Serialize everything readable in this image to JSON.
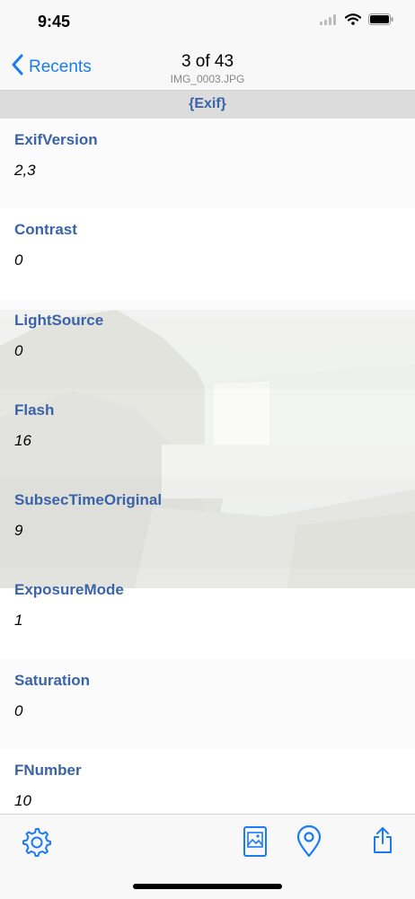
{
  "status_bar": {
    "time": "9:45"
  },
  "nav": {
    "back_label": "Recents",
    "title": "3 of 43",
    "subtitle": "IMG_0003.JPG"
  },
  "section": {
    "title": "{Exif}"
  },
  "rows": [
    {
      "key": "ExifVersion",
      "value": "2,3"
    },
    {
      "key": "Contrast",
      "value": "0"
    },
    {
      "key": "LightSource",
      "value": "0"
    },
    {
      "key": "Flash",
      "value": "16"
    },
    {
      "key": "SubsecTimeOriginal",
      "value": "9"
    },
    {
      "key": "ExposureMode",
      "value": "1"
    },
    {
      "key": "Saturation",
      "value": "0"
    },
    {
      "key": "FNumber",
      "value": "10"
    }
  ],
  "toolbar": {
    "items": [
      "gear-icon",
      "photo-icon",
      "location-pin-icon",
      "share-icon"
    ]
  },
  "colors": {
    "accent": "#1a7cf5",
    "key_text": "#3a63a8",
    "section_bg": "#dcdcdc"
  }
}
